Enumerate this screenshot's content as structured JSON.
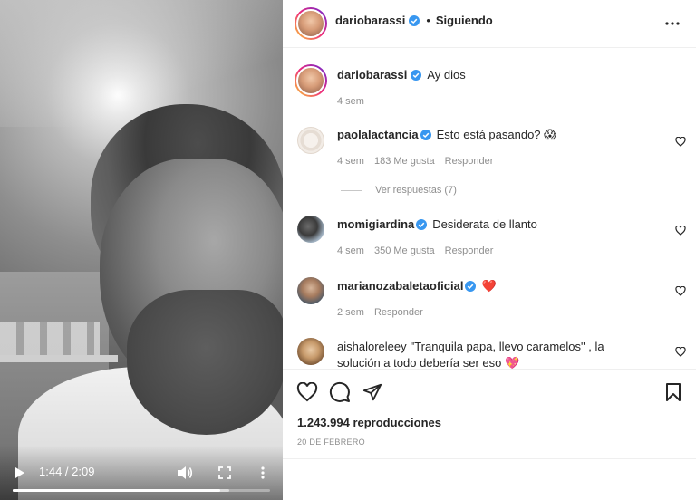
{
  "colors": {
    "accent_blue": "#0095f6",
    "verified": "#3897f0",
    "text": "#262626",
    "muted": "#8e8e8e",
    "heart_red": "#ed4956"
  },
  "video": {
    "time_display": "1:44 / 2:09",
    "progress_fraction": 0.805,
    "buffered_fraction": 0.84,
    "icons": {
      "play": "play-icon",
      "volume": "volume-icon",
      "fullscreen": "fullscreen-icon",
      "more": "more-vertical-icon"
    }
  },
  "header": {
    "username": "dariobarassi",
    "separator": "•",
    "follow_status": "Siguiendo",
    "options_icon": "more-horizontal-icon"
  },
  "caption": {
    "username": "dariobarassi",
    "text": "Ay dios",
    "time": "4 sem"
  },
  "comments": [
    {
      "username": "paolalactancia",
      "verified": true,
      "text": "Esto está pasando? 😱",
      "time": "4 sem",
      "likes": "183 Me gusta",
      "reply_label": "Responder"
    },
    {
      "username": "momigiardina",
      "verified": true,
      "text": "Desiderata de llanto",
      "time": "4 sem",
      "likes": "350 Me gusta",
      "reply_label": "Responder"
    },
    {
      "username": "marianozabaletaoficial",
      "verified": true,
      "text": "❤️",
      "time": "2 sem",
      "likes": "",
      "reply_label": "Responder"
    },
    {
      "username": "aishaloreleey",
      "verified": false,
      "text": "\"Tranquila papa, llevo caramelos\" , la solución a todo debería ser eso 💖",
      "time": "",
      "likes": "",
      "reply_label": ""
    }
  ],
  "view_replies": "Ver respuestas (7)",
  "actions": {
    "icons": [
      "heart-icon",
      "comment-icon",
      "share-icon",
      "bookmark-icon"
    ],
    "views": "1.243.994 reproducciones",
    "date": "20 DE FEBRERO"
  }
}
